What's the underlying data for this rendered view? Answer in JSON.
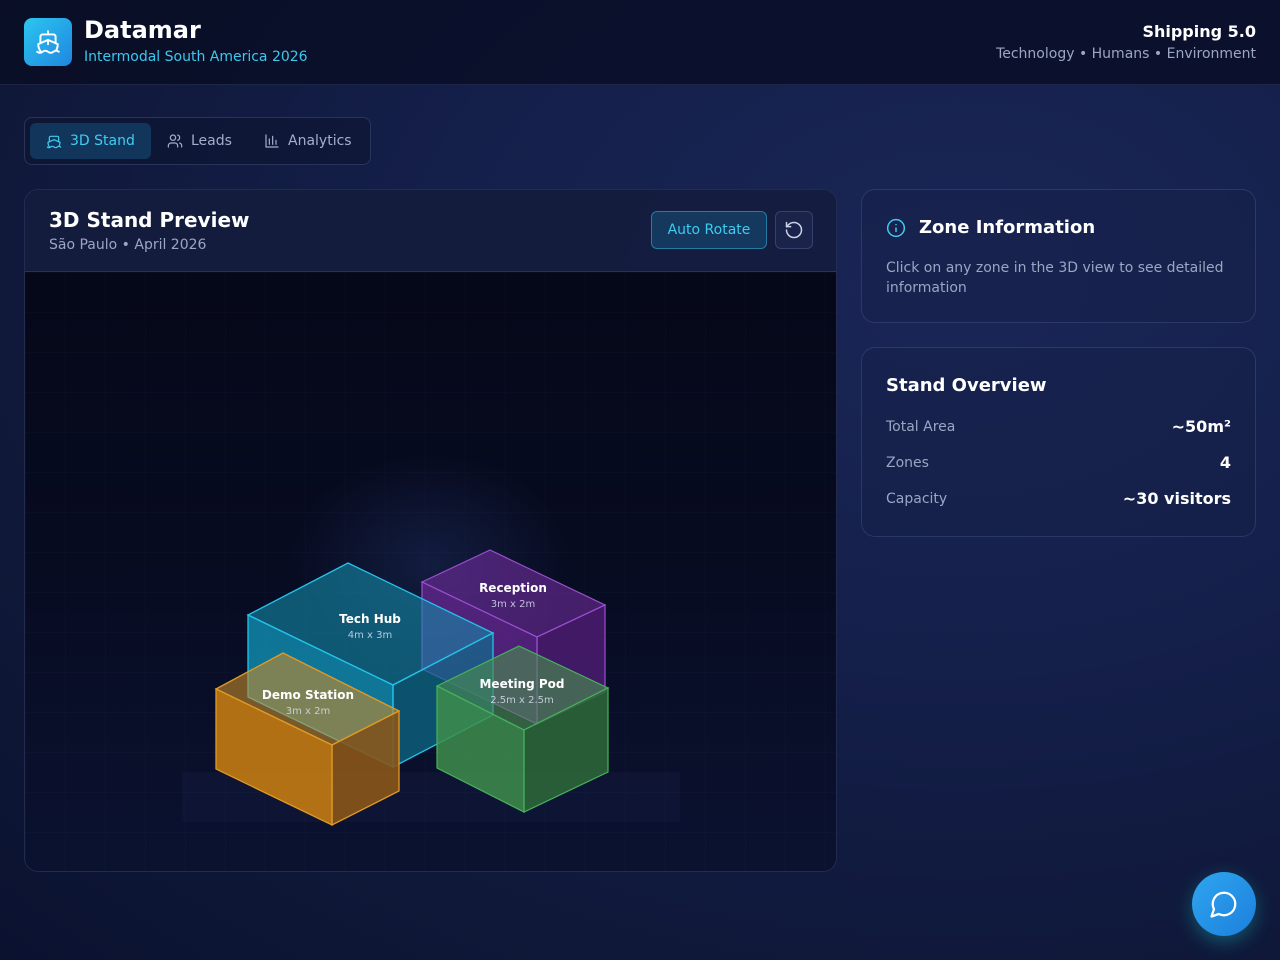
{
  "header": {
    "brand_name": "Datamar",
    "brand_subtitle": "Intermodal South America 2026",
    "logo_icon": "ship-icon",
    "right_title": "Shipping 5.0",
    "right_subtitle": "Technology • Humans • Environment"
  },
  "tabs": [
    {
      "label": "3D Stand",
      "icon": "ship-icon",
      "active": true
    },
    {
      "label": "Leads",
      "icon": "users-icon",
      "active": false
    },
    {
      "label": "Analytics",
      "icon": "bar-chart-icon",
      "active": false
    }
  ],
  "viewer": {
    "title": "3D Stand Preview",
    "subtitle": "São Paulo • April 2026",
    "auto_rotate_label": "Auto Rotate",
    "reset_icon": "rotate-ccw-icon",
    "zones": [
      {
        "name": "Tech Hub",
        "size": "4m x 3m",
        "color": "#1fb6d8"
      },
      {
        "name": "Reception",
        "size": "3m x 2m",
        "color": "#8a2bb8"
      },
      {
        "name": "Demo Station",
        "size": "3m x 2m",
        "color": "#e2901c"
      },
      {
        "name": "Meeting Pod",
        "size": "2.5m x 2.5m",
        "color": "#3a9a4e"
      }
    ]
  },
  "zone_info": {
    "title": "Zone Information",
    "icon": "info-icon",
    "text": "Click on any zone in the 3D view to see detailed information"
  },
  "overview": {
    "title": "Stand Overview",
    "rows": [
      {
        "label": "Total Area",
        "value": "~50m²"
      },
      {
        "label": "Zones",
        "value": "4"
      },
      {
        "label": "Capacity",
        "value": "~30 visitors"
      }
    ]
  },
  "chat": {
    "icon": "chat-bubble-icon"
  }
}
